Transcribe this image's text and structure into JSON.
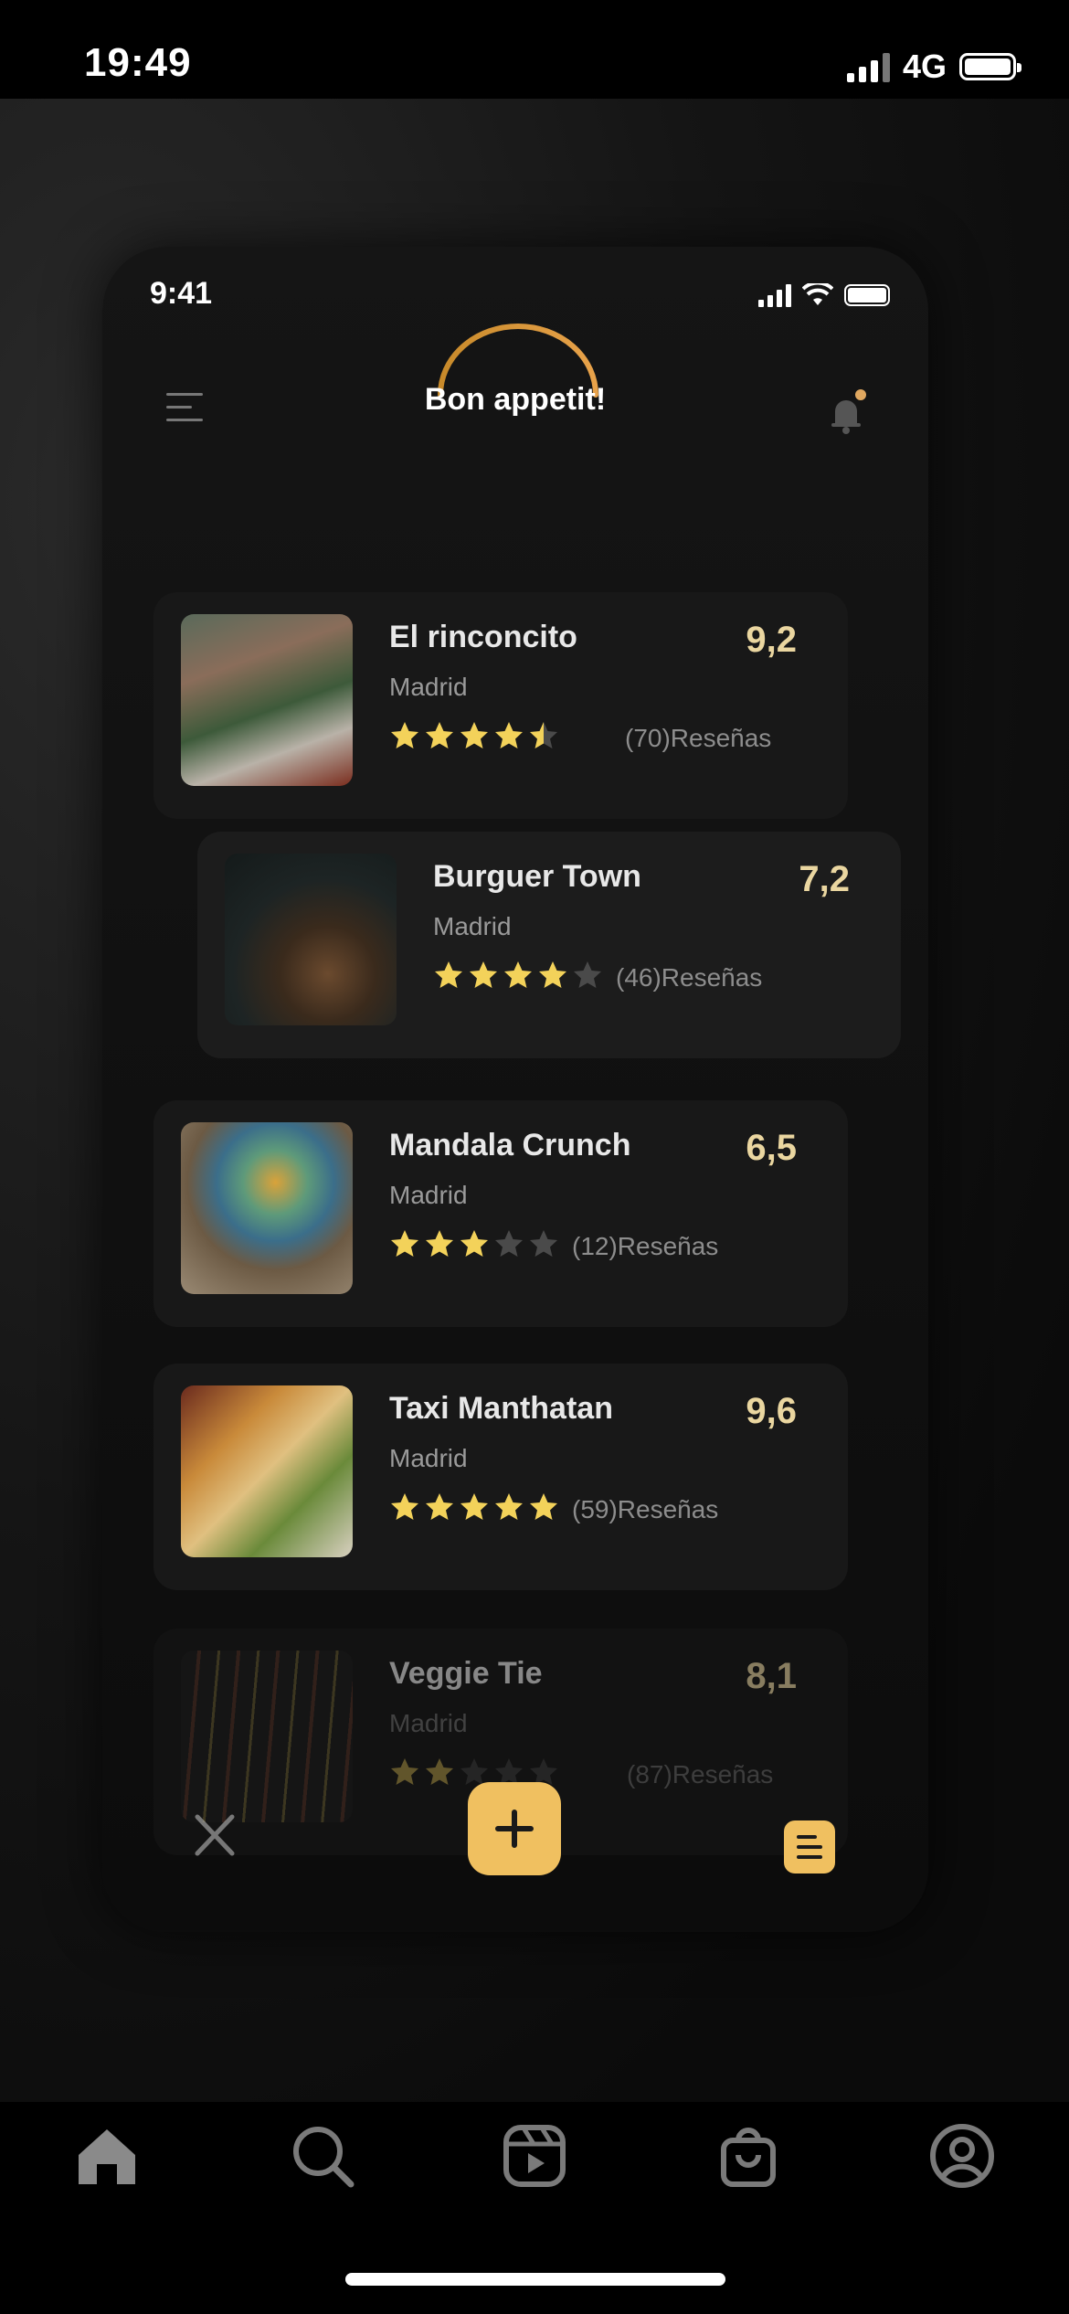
{
  "status_bar": {
    "time": "19:49",
    "network": "4G"
  },
  "app": {
    "status_time": "9:41",
    "brand": "Bon appetit!",
    "accent_color": "#f0c060",
    "restaurants": [
      {
        "name": "El rinconcito",
        "city": "Madrid",
        "score": "9,2",
        "rating": 4.5,
        "reviews": "(70)Reseñas"
      },
      {
        "name": "Burguer Town",
        "city": "Madrid",
        "score": "7,2",
        "rating": 4,
        "reviews": "(46)Reseñas"
      },
      {
        "name": "Mandala Crunch",
        "city": "Madrid",
        "score": "6,5",
        "rating": 3,
        "reviews": "(12)Reseñas"
      },
      {
        "name": "Taxi Manthatan",
        "city": "Madrid",
        "score": "9,6",
        "rating": 5,
        "reviews": "(59)Reseñas"
      },
      {
        "name": "Veggie Tie",
        "city": "Madrid",
        "score": "8,1",
        "rating": 2,
        "reviews": "(87)Reseñas"
      }
    ],
    "icons": {
      "left": "fork-knife-icon",
      "center": "add-icon",
      "right": "list-icon"
    }
  },
  "bottom_nav": [
    "home-icon",
    "search-icon",
    "reels-icon",
    "shop-icon",
    "profile-icon"
  ]
}
